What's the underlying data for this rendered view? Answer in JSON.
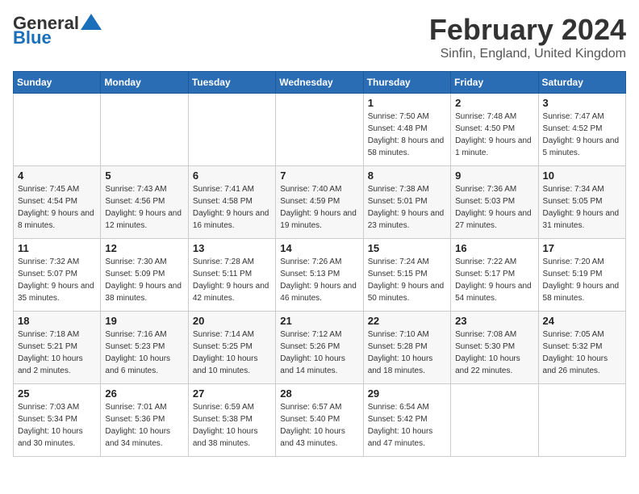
{
  "header": {
    "logo_general": "General",
    "logo_blue": "Blue",
    "month_title": "February 2024",
    "location": "Sinfin, England, United Kingdom"
  },
  "weekdays": [
    "Sunday",
    "Monday",
    "Tuesday",
    "Wednesday",
    "Thursday",
    "Friday",
    "Saturday"
  ],
  "weeks": [
    [
      {
        "day": "",
        "sunrise": "",
        "sunset": "",
        "daylight": ""
      },
      {
        "day": "",
        "sunrise": "",
        "sunset": "",
        "daylight": ""
      },
      {
        "day": "",
        "sunrise": "",
        "sunset": "",
        "daylight": ""
      },
      {
        "day": "",
        "sunrise": "",
        "sunset": "",
        "daylight": ""
      },
      {
        "day": "1",
        "sunrise": "Sunrise: 7:50 AM",
        "sunset": "Sunset: 4:48 PM",
        "daylight": "Daylight: 8 hours and 58 minutes."
      },
      {
        "day": "2",
        "sunrise": "Sunrise: 7:48 AM",
        "sunset": "Sunset: 4:50 PM",
        "daylight": "Daylight: 9 hours and 1 minute."
      },
      {
        "day": "3",
        "sunrise": "Sunrise: 7:47 AM",
        "sunset": "Sunset: 4:52 PM",
        "daylight": "Daylight: 9 hours and 5 minutes."
      }
    ],
    [
      {
        "day": "4",
        "sunrise": "Sunrise: 7:45 AM",
        "sunset": "Sunset: 4:54 PM",
        "daylight": "Daylight: 9 hours and 8 minutes."
      },
      {
        "day": "5",
        "sunrise": "Sunrise: 7:43 AM",
        "sunset": "Sunset: 4:56 PM",
        "daylight": "Daylight: 9 hours and 12 minutes."
      },
      {
        "day": "6",
        "sunrise": "Sunrise: 7:41 AM",
        "sunset": "Sunset: 4:58 PM",
        "daylight": "Daylight: 9 hours and 16 minutes."
      },
      {
        "day": "7",
        "sunrise": "Sunrise: 7:40 AM",
        "sunset": "Sunset: 4:59 PM",
        "daylight": "Daylight: 9 hours and 19 minutes."
      },
      {
        "day": "8",
        "sunrise": "Sunrise: 7:38 AM",
        "sunset": "Sunset: 5:01 PM",
        "daylight": "Daylight: 9 hours and 23 minutes."
      },
      {
        "day": "9",
        "sunrise": "Sunrise: 7:36 AM",
        "sunset": "Sunset: 5:03 PM",
        "daylight": "Daylight: 9 hours and 27 minutes."
      },
      {
        "day": "10",
        "sunrise": "Sunrise: 7:34 AM",
        "sunset": "Sunset: 5:05 PM",
        "daylight": "Daylight: 9 hours and 31 minutes."
      }
    ],
    [
      {
        "day": "11",
        "sunrise": "Sunrise: 7:32 AM",
        "sunset": "Sunset: 5:07 PM",
        "daylight": "Daylight: 9 hours and 35 minutes."
      },
      {
        "day": "12",
        "sunrise": "Sunrise: 7:30 AM",
        "sunset": "Sunset: 5:09 PM",
        "daylight": "Daylight: 9 hours and 38 minutes."
      },
      {
        "day": "13",
        "sunrise": "Sunrise: 7:28 AM",
        "sunset": "Sunset: 5:11 PM",
        "daylight": "Daylight: 9 hours and 42 minutes."
      },
      {
        "day": "14",
        "sunrise": "Sunrise: 7:26 AM",
        "sunset": "Sunset: 5:13 PM",
        "daylight": "Daylight: 9 hours and 46 minutes."
      },
      {
        "day": "15",
        "sunrise": "Sunrise: 7:24 AM",
        "sunset": "Sunset: 5:15 PM",
        "daylight": "Daylight: 9 hours and 50 minutes."
      },
      {
        "day": "16",
        "sunrise": "Sunrise: 7:22 AM",
        "sunset": "Sunset: 5:17 PM",
        "daylight": "Daylight: 9 hours and 54 minutes."
      },
      {
        "day": "17",
        "sunrise": "Sunrise: 7:20 AM",
        "sunset": "Sunset: 5:19 PM",
        "daylight": "Daylight: 9 hours and 58 minutes."
      }
    ],
    [
      {
        "day": "18",
        "sunrise": "Sunrise: 7:18 AM",
        "sunset": "Sunset: 5:21 PM",
        "daylight": "Daylight: 10 hours and 2 minutes."
      },
      {
        "day": "19",
        "sunrise": "Sunrise: 7:16 AM",
        "sunset": "Sunset: 5:23 PM",
        "daylight": "Daylight: 10 hours and 6 minutes."
      },
      {
        "day": "20",
        "sunrise": "Sunrise: 7:14 AM",
        "sunset": "Sunset: 5:25 PM",
        "daylight": "Daylight: 10 hours and 10 minutes."
      },
      {
        "day": "21",
        "sunrise": "Sunrise: 7:12 AM",
        "sunset": "Sunset: 5:26 PM",
        "daylight": "Daylight: 10 hours and 14 minutes."
      },
      {
        "day": "22",
        "sunrise": "Sunrise: 7:10 AM",
        "sunset": "Sunset: 5:28 PM",
        "daylight": "Daylight: 10 hours and 18 minutes."
      },
      {
        "day": "23",
        "sunrise": "Sunrise: 7:08 AM",
        "sunset": "Sunset: 5:30 PM",
        "daylight": "Daylight: 10 hours and 22 minutes."
      },
      {
        "day": "24",
        "sunrise": "Sunrise: 7:05 AM",
        "sunset": "Sunset: 5:32 PM",
        "daylight": "Daylight: 10 hours and 26 minutes."
      }
    ],
    [
      {
        "day": "25",
        "sunrise": "Sunrise: 7:03 AM",
        "sunset": "Sunset: 5:34 PM",
        "daylight": "Daylight: 10 hours and 30 minutes."
      },
      {
        "day": "26",
        "sunrise": "Sunrise: 7:01 AM",
        "sunset": "Sunset: 5:36 PM",
        "daylight": "Daylight: 10 hours and 34 minutes."
      },
      {
        "day": "27",
        "sunrise": "Sunrise: 6:59 AM",
        "sunset": "Sunset: 5:38 PM",
        "daylight": "Daylight: 10 hours and 38 minutes."
      },
      {
        "day": "28",
        "sunrise": "Sunrise: 6:57 AM",
        "sunset": "Sunset: 5:40 PM",
        "daylight": "Daylight: 10 hours and 43 minutes."
      },
      {
        "day": "29",
        "sunrise": "Sunrise: 6:54 AM",
        "sunset": "Sunset: 5:42 PM",
        "daylight": "Daylight: 10 hours and 47 minutes."
      },
      {
        "day": "",
        "sunrise": "",
        "sunset": "",
        "daylight": ""
      },
      {
        "day": "",
        "sunrise": "",
        "sunset": "",
        "daylight": ""
      }
    ]
  ]
}
